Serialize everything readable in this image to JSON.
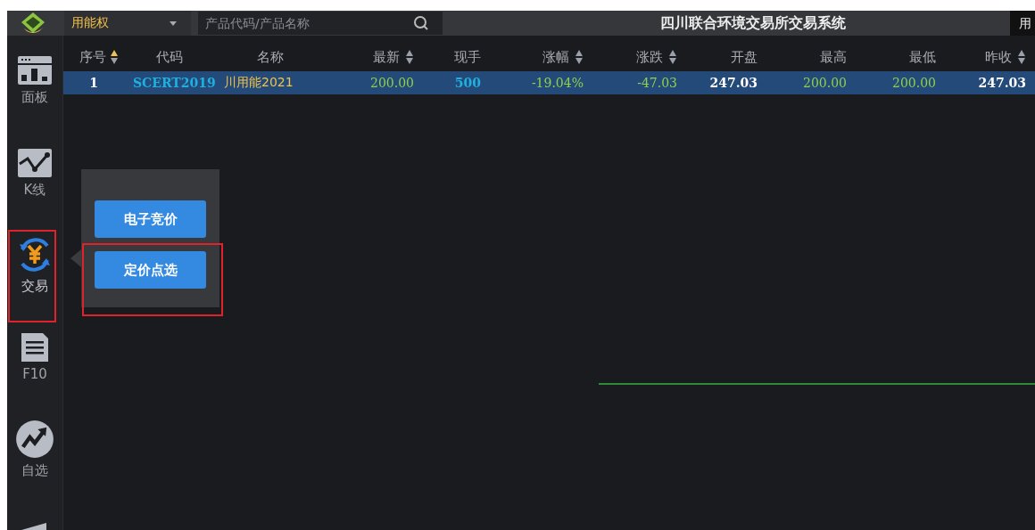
{
  "topbar": {
    "market": "用能权",
    "search": {
      "placeholder": "产品代码/产品名称"
    },
    "title": "四川联合环境交易所交易系统",
    "user": "用"
  },
  "sidebar": {
    "items": [
      {
        "kind": "panel",
        "label": "面板",
        "selected": false,
        "highlighted": false
      },
      {
        "kind": "kline",
        "label": "K线",
        "selected": false,
        "highlighted": false
      },
      {
        "kind": "trade",
        "label": "交易",
        "selected": true,
        "highlighted": true
      },
      {
        "kind": "doc",
        "label": "F10",
        "selected": false,
        "highlighted": false
      },
      {
        "kind": "watch",
        "label": "自选",
        "selected": false,
        "highlighted": false
      },
      {
        "kind": "more"
      }
    ]
  },
  "table": {
    "columns": [
      {
        "label": "序号",
        "sortable": true,
        "sorted": true
      },
      {
        "label": "代码"
      },
      {
        "label": "名称"
      },
      {
        "label": "最新",
        "sortable": true,
        "sorted": false
      },
      {
        "label": "现手"
      },
      {
        "label": "涨幅",
        "sortable": true,
        "sorted": false
      },
      {
        "label": "涨跌",
        "sortable": true,
        "sorted": false
      },
      {
        "label": "开盘"
      },
      {
        "label": "最高"
      },
      {
        "label": "最低"
      },
      {
        "label": "昨收",
        "sortable": true,
        "sorted": false
      }
    ],
    "rows": [
      {
        "selected": true,
        "cells": [
          {
            "text": "1",
            "color": "#ffffff"
          },
          {
            "text": "SCERT2019",
            "color": "#1fb0e0"
          },
          {
            "text": "川用能2021",
            "color": "#f2c24a"
          },
          {
            "text": "200.00",
            "color": "#8fcf4e"
          },
          {
            "text": "500",
            "color": "#1fb0e0"
          },
          {
            "text": "-19.04%",
            "color": "#8fcf4e"
          },
          {
            "text": "-47.03",
            "color": "#8fcf4e"
          },
          {
            "text": "247.03",
            "color": "#ffffff"
          },
          {
            "text": "200.00",
            "color": "#8fcf4e"
          },
          {
            "text": "200.00",
            "color": "#8fcf4e"
          },
          {
            "text": "247.03",
            "color": "#ffffff"
          }
        ]
      }
    ]
  },
  "trade_menu": {
    "buttons": [
      {
        "label": "电子竞价",
        "highlighted": false
      },
      {
        "label": "定价点选",
        "highlighted": true
      }
    ]
  }
}
